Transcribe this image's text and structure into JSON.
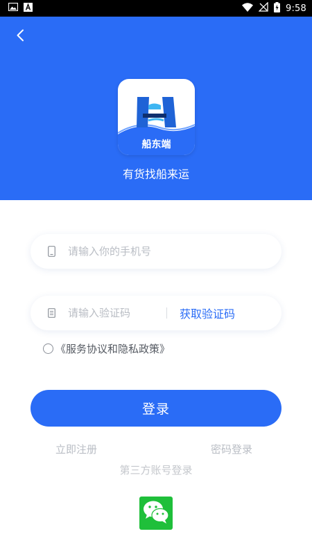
{
  "status_bar": {
    "time": "9:58",
    "left_icons": [
      "image-icon",
      "text-a-icon"
    ],
    "right_icons": [
      "wifi-icon",
      "no-signal-icon",
      "battery-charging-icon"
    ]
  },
  "header": {
    "background": "#2a6cf6",
    "back_icon": "chevron-left-icon",
    "logo_text": "船东端",
    "slogan": "有货找船来运"
  },
  "form": {
    "phone_placeholder": "请输入你的手机号",
    "phone_icon": "phone-icon",
    "code_placeholder": "请输入验证码",
    "code_icon": "document-icon",
    "get_code_label": "获取验证码",
    "agreement": "《服务协议和隐私政策》",
    "agreement_checked": false
  },
  "actions": {
    "login_label": "登录",
    "register_label": "立即注册",
    "password_login_label": "密码登录",
    "third_party_label": "第三方账号登录",
    "wechat_icon": "wechat-icon"
  },
  "colors": {
    "accent": "#2a6cf6",
    "wechat": "#1fbf3a",
    "muted_text": "#b9bdc4"
  }
}
